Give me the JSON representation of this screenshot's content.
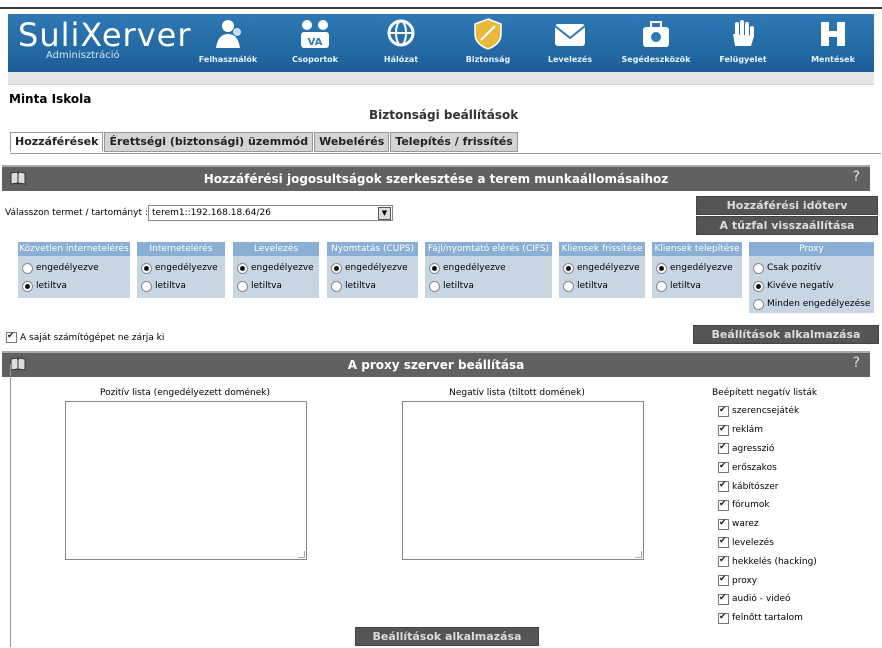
{
  "app": {
    "logo": "SuliXerver",
    "logo_sub": "Adminisztráció"
  },
  "nav": [
    {
      "label": "Felhasználók",
      "icon": "users-icon"
    },
    {
      "label": "Csoportok",
      "icon": "groups-icon"
    },
    {
      "label": "Hálózat",
      "icon": "network-globe-icon"
    },
    {
      "label": "Biztonság",
      "icon": "shield-icon"
    },
    {
      "label": "Levelezés",
      "icon": "mail-icon"
    },
    {
      "label": "Segédeszközök",
      "icon": "toolbox-icon"
    },
    {
      "label": "Felügyelet",
      "icon": "hand-icon"
    },
    {
      "label": "Mentések",
      "icon": "backup-icon"
    }
  ],
  "school": "Minta Iskola",
  "page_title": "Biztonsági beállítások",
  "tabs": [
    "Hozzáférések",
    "Érettségi (biztonsági) üzemmód",
    "Webelérés",
    "Telepítés / frissítés"
  ],
  "access": {
    "panel_title": "Hozzáférési jogosultságok szerkesztése a terem munkaállomásaihoz",
    "help": "?",
    "select_label": "Válasszon termet / tartományt :",
    "select_value": "terem1::192.168.18.64/26",
    "btn_schedule": "Hozzáférési időterv",
    "btn_restore": "A tűzfal visszaállítása",
    "columns": [
      {
        "title": "Közvetlen internetelérés",
        "options": [
          {
            "label": "engedélyezve",
            "checked": false
          },
          {
            "label": "letiltva",
            "checked": true
          }
        ]
      },
      {
        "title": "Internetelérés",
        "options": [
          {
            "label": "engedélyezve",
            "checked": true
          },
          {
            "label": "letiltva",
            "checked": false
          }
        ]
      },
      {
        "title": "Levelezés",
        "options": [
          {
            "label": "engedélyezve",
            "checked": true
          },
          {
            "label": "letiltva",
            "checked": false
          }
        ]
      },
      {
        "title": "Nyomtatás (CUPS)",
        "options": [
          {
            "label": "engedélyezve",
            "checked": true
          },
          {
            "label": "letiltva",
            "checked": false
          }
        ]
      },
      {
        "title": "Fájl/nyomtató elérés (CIFS)",
        "options": [
          {
            "label": "engedélyezve",
            "checked": true
          },
          {
            "label": "letiltva",
            "checked": false
          }
        ]
      },
      {
        "title": "Kliensek frissítése",
        "options": [
          {
            "label": "engedélyezve",
            "checked": true
          },
          {
            "label": "letiltva",
            "checked": false
          }
        ]
      },
      {
        "title": "Kliensek telepítése",
        "options": [
          {
            "label": "engedélyezve",
            "checked": true
          },
          {
            "label": "letiltva",
            "checked": false
          }
        ]
      },
      {
        "title": "Proxy",
        "options": [
          {
            "label": "Csak pozitív",
            "checked": false
          },
          {
            "label": "Kivéve negatív",
            "checked": true
          },
          {
            "label": "Minden engedélyezése",
            "checked": false
          }
        ]
      }
    ],
    "own_pc_label": "A saját számítógépet ne zárja ki",
    "own_pc_checked": true,
    "btn_apply": "Beállítások alkalmazása"
  },
  "proxy": {
    "panel_title": "A proxy szerver beállítása",
    "help": "?",
    "positive_label": "Pozitív lista (engedélyezett domének)",
    "negative_label": "Negatív lista (tiltott domének)",
    "builtin_title": "Beépített negatív listák",
    "builtin": [
      {
        "label": "szerencsejáték",
        "checked": true
      },
      {
        "label": "reklám",
        "checked": true
      },
      {
        "label": "agresszió",
        "checked": true
      },
      {
        "label": "erőszakos",
        "checked": true
      },
      {
        "label": "kábítószer",
        "checked": true
      },
      {
        "label": "fórumok",
        "checked": true
      },
      {
        "label": "warez",
        "checked": true
      },
      {
        "label": "levelezés",
        "checked": true
      },
      {
        "label": "hekkelés (hacking)",
        "checked": true
      },
      {
        "label": "proxy",
        "checked": true
      },
      {
        "label": "audió - videó",
        "checked": true
      },
      {
        "label": "felnőtt tartalom",
        "checked": true
      }
    ],
    "btn_apply": "Beállítások alkalmazása"
  },
  "colors": {
    "header": "#2f79b4",
    "panel": "#616161",
    "colhead": "#8aaed4",
    "colbody": "#c8d6e4"
  }
}
